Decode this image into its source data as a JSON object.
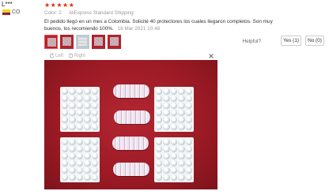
{
  "reviewer": {
    "username": "L***",
    "country_code": "CO",
    "flag_colors": [
      "#fcd116",
      "#003893",
      "#ce1126"
    ]
  },
  "rating": {
    "stars": 5,
    "star_glyphs": "★★★★★",
    "color": "#e62e04"
  },
  "meta": {
    "color_label": "Color:",
    "color_value": "2",
    "shipping": "AliExpress Standard Shipping"
  },
  "review": {
    "text": "El pedido llegó en un mes a Colombia. Solicité 40 protectores los cuales llegaron completos. Son muy buenos, los recomiendo 100%.",
    "date": "18 Mar 2021 10:48"
  },
  "feedback": {
    "helpful_label": "Helpful?",
    "yes_label": "Yes (1)",
    "no_label": "No (0)"
  },
  "viewer": {
    "rotate_left_label": "Left",
    "rotate_right_label": "Right",
    "thumbnail_count": 5,
    "selected_index": 0
  },
  "colors": {
    "accent": "#ff4747",
    "photo_background": "#a51e28"
  }
}
